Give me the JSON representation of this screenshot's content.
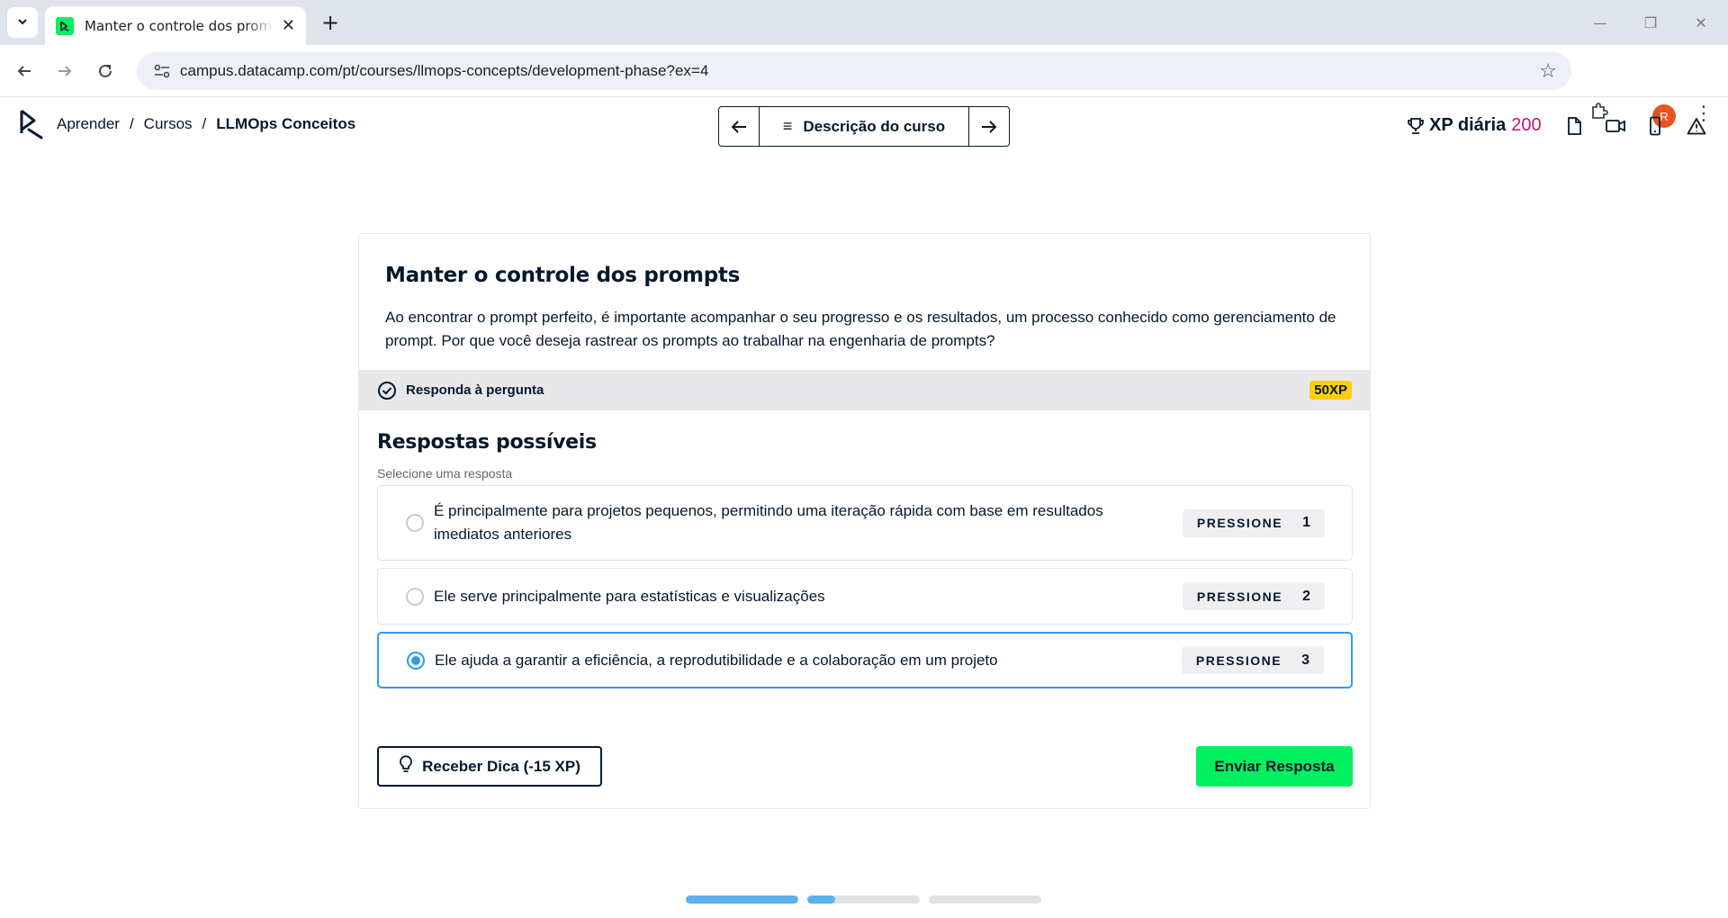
{
  "browser": {
    "tab_title": "Manter o controle dos prompts",
    "url": "campus.datacamp.com/pt/courses/llmops-concepts/development-phase?ex=4",
    "profile_initial": "R",
    "icons": [
      "chevron-down-icon",
      "close-icon",
      "plus-icon",
      "back-icon",
      "forward-icon",
      "reload-icon",
      "site-info-icon",
      "star-icon",
      "extensions-icon",
      "kebab-icon"
    ]
  },
  "header": {
    "breadcrumb": [
      "Aprender",
      "Cursos",
      "LLMOps Conceitos"
    ],
    "course_nav_label": "Descrição do curso",
    "xp_label": "XP diária",
    "xp_value": "200",
    "icons": [
      "trophy-icon",
      "document-icon",
      "video-icon",
      "mobile-icon",
      "warning-icon"
    ]
  },
  "exercise": {
    "title": "Manter o controle dos prompts",
    "body": "Ao encontrar o prompt perfeito, é importante acompanhar o seu progresso e os resultados, um processo conhecido como gerenciamento de prompt. Por que você deseja rastrear os prompts ao trabalhar na engenharia de prompts?",
    "task_label": "Responda à pergunta",
    "xp_badge": "50XP"
  },
  "answers": {
    "title": "Respostas possíveis",
    "subtitle": "Selecione uma resposta",
    "options": [
      {
        "text": "É principalmente para projetos pequenos, permitindo uma iteração rápida com base em resultados imediatos anteriores",
        "press_label": "PRESSIONE",
        "key": "1",
        "selected": false
      },
      {
        "text": "Ele serve principalmente para estatísticas e visualizações",
        "press_label": "PRESSIONE",
        "key": "2",
        "selected": false
      },
      {
        "text": "Ele ajuda a garantir a eficiência, a reprodutibilidade e a colaboração em um projeto",
        "press_label": "PRESSIONE",
        "key": "3",
        "selected": true
      }
    ]
  },
  "actions": {
    "hint_label": "Receber Dica (-15 XP)",
    "submit_label": "Enviar Resposta"
  },
  "progress": {
    "segments": [
      1.0,
      0.25,
      0.0
    ]
  },
  "colors": {
    "accent_green": "#03ef62",
    "selected_blue": "#2e9bf0",
    "xp_magenta": "#c01878",
    "xp_badge_yellow": "#fcce0d",
    "navy_text": "#05192d"
  }
}
